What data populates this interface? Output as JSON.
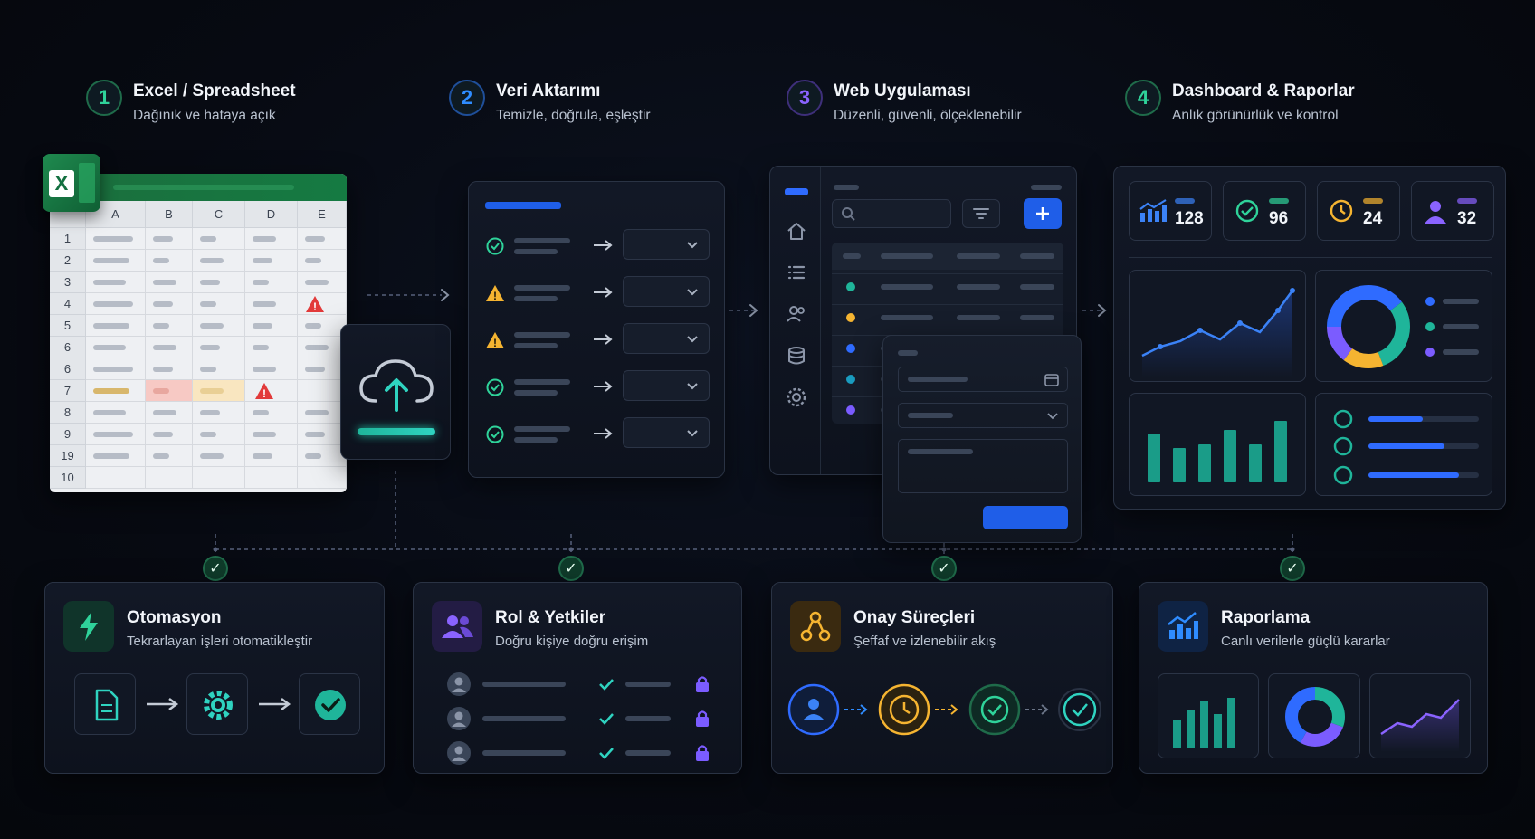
{
  "steps": [
    {
      "num": "1",
      "title": "Excel / Spreadsheet",
      "subtitle": "Dağınık ve hataya açık",
      "color": "#2fd39a"
    },
    {
      "num": "2",
      "title": "Veri Aktarımı",
      "subtitle": "Temizle, doğrula, eşleştir",
      "color": "#2f8cff"
    },
    {
      "num": "3",
      "title": "Web Uygulaması",
      "subtitle": "Düzenli, güvenli, ölçeklenebilir",
      "color": "#8a63ff"
    },
    {
      "num": "4",
      "title": "Dashboard & Raporlar",
      "subtitle": "Anlık görünürlük ve kontrol",
      "color": "#2fd39a"
    }
  ],
  "spreadsheet": {
    "columns": [
      "A",
      "B",
      "C",
      "D",
      "E"
    ],
    "rows": [
      "1",
      "2",
      "3",
      "4",
      "5",
      "6",
      "6",
      "7",
      "8",
      "9",
      "19",
      "10"
    ]
  },
  "dashboard": {
    "stats": [
      {
        "value": "128",
        "icon": "chart-up-icon",
        "color": "#3b82f6"
      },
      {
        "value": "96",
        "icon": "check-circle-icon",
        "color": "#2fd39a"
      },
      {
        "value": "24",
        "icon": "clock-icon",
        "color": "#f5b431"
      },
      {
        "value": "32",
        "icon": "user-icon",
        "color": "#8a63ff"
      }
    ],
    "colors": {
      "blue": "#2f6bff",
      "teal": "#1fb59a",
      "yellow": "#f5b431",
      "purple": "#7b5cff"
    }
  },
  "features": [
    {
      "title": "Otomasyon",
      "subtitle": "Tekrarlayan işleri otomatikleştir",
      "icon": "lightning-icon",
      "color": "#2fd39a"
    },
    {
      "title": "Rol & Yetkiler",
      "subtitle": "Doğru kişiye doğru erişim",
      "icon": "users-icon",
      "color": "#8a63ff"
    },
    {
      "title": "Onay Süreçleri",
      "subtitle": "Şeffaf ve izlenebilir akış",
      "icon": "workflow-icon",
      "color": "#f5b431"
    },
    {
      "title": "Raporlama",
      "subtitle": "Canlı verilerle güçlü kararlar",
      "icon": "chart-up-icon",
      "color": "#2f8cff"
    }
  ]
}
